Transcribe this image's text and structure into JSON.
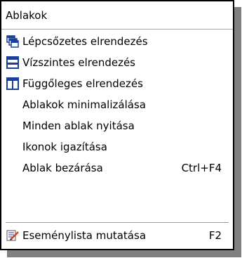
{
  "menu": {
    "title": "Ablakok",
    "items": [
      {
        "label": "Lépcsőzetes elrendezés",
        "icon": "cascade-windows-icon",
        "shortcut": ""
      },
      {
        "label": "Vízszintes elrendezés",
        "icon": "tile-horizontal-icon",
        "shortcut": ""
      },
      {
        "label": "Függőleges elrendezés",
        "icon": "tile-vertical-icon",
        "shortcut": ""
      },
      {
        "label": "Ablakok minimalizálása",
        "icon": "",
        "shortcut": ""
      },
      {
        "label": "Minden ablak nyitása",
        "icon": "",
        "shortcut": ""
      },
      {
        "label": "Ikonok igazítása",
        "icon": "",
        "shortcut": ""
      },
      {
        "label": "Ablak bezárása",
        "icon": "",
        "shortcut": "Ctrl+F4"
      },
      {
        "label": "Eseménylista mutatása",
        "icon": "event-list-icon",
        "shortcut": "F2"
      }
    ]
  },
  "colors": {
    "icon_blue": "#1c3f9c",
    "shadow": "#808080",
    "border": "#000000"
  }
}
